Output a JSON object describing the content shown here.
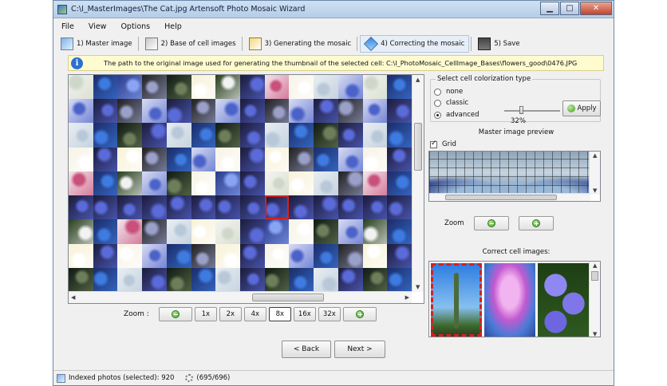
{
  "window": {
    "title": "C:\\I_MasterImages\\The Cat.jpg Artensoft Photo Mosaic Wizard",
    "buttons": {
      "minimize": "▁",
      "maximize": "□",
      "close": "✕"
    }
  },
  "menu": [
    "File",
    "View",
    "Options",
    "Help"
  ],
  "steps": [
    {
      "label": "1) Master image",
      "icon": "master-image-icon"
    },
    {
      "label": "2) Base of cell images",
      "icon": "cell-base-icon"
    },
    {
      "label": "3) Generating the mosaic",
      "icon": "magic-wand-icon"
    },
    {
      "label": "4) Correcting the mosaic",
      "icon": "cube-icon",
      "active": true
    },
    {
      "label": "5) Save",
      "icon": "floppy-disk-icon"
    }
  ],
  "info": {
    "icon": "i",
    "text": "The path to the original image used for generating the thumbnail of the selected cell: C:\\I_PhotoMosaic_CellImage_Bases\\flowers_good\\0476.JPG"
  },
  "zoom": {
    "label": "Zoom :",
    "levels": [
      "1x",
      "2x",
      "4x",
      "8x",
      "16x",
      "32x"
    ],
    "active": "8x"
  },
  "nav": {
    "back": "< Back",
    "next": "Next >"
  },
  "colorization": {
    "title": "Select cell colorization type",
    "options": [
      "none",
      "classic",
      "advanced"
    ],
    "selected": "advanced",
    "value": "32%",
    "value_fraction": 0.32,
    "apply": "Apply"
  },
  "preview": {
    "title": "Master image preview",
    "grid_label": "Grid",
    "grid_checked": true,
    "zoom_label": "Zoom"
  },
  "correct": {
    "title": "Correct cell images:"
  },
  "status": {
    "indexed": "Indexed photos (selected): 920",
    "progress": "(695/696)"
  },
  "colors": {
    "accent": "#2b6fd1",
    "selection": "#d52020",
    "info_bg": "#fffbd0"
  }
}
